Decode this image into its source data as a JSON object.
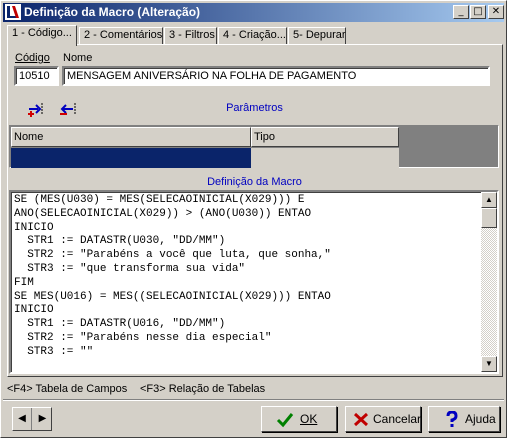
{
  "window": {
    "title": "Definição da Macro (Alteração)",
    "minimize_glyph": "_",
    "maximize_glyph": "□",
    "close_glyph": "✕"
  },
  "tabs": [
    {
      "label": "1 - Código...",
      "active": true
    },
    {
      "label": "2 - Comentários",
      "active": false
    },
    {
      "label": "3 - Filtros",
      "active": false
    },
    {
      "label": "4 - Criação...",
      "active": false
    },
    {
      "label": "5- Depurar",
      "active": false
    }
  ],
  "form": {
    "codigo_label": "Código",
    "codigo_value": "10510",
    "nome_label": "Nome",
    "nome_value": "MENSAGEM ANIVERSÁRIO NA FOLHA DE PAGAMENTO"
  },
  "parametros": {
    "title": "Parâmetros",
    "add_icon": "add-parameter-icon",
    "remove_icon": "remove-parameter-icon",
    "columns": [
      "Nome",
      "Tipo"
    ]
  },
  "definicao": {
    "title": "Definição da Macro",
    "code": "SE (MES(U030) = MES(SELECAOINICIAL(X029))) E\nANO(SELECAOINICIAL(X029)) > (ANO(U030)) ENTAO\nINICIO\n  STR1 := DATASTR(U030, \"DD/MM\")\n  STR2 := \"Parabéns a você que luta, que sonha,\"\n  STR3 := \"que transforma sua vida\"\nFIM\nSE MES(U016) = MES((SELECAOINICIAL(X029))) ENTAO\nINICIO\n  STR1 := DATASTR(U016, \"DD/MM\")\n  STR2 := \"Parabéns nesse dia especial\"\n  STR3 := \"\""
  },
  "statusbar": {
    "hint1": "<F4> Tabela de Campos",
    "hint2": "<F3> Relação de Tabelas"
  },
  "buttons": {
    "ok": "OK",
    "cancelar": "Cancelar",
    "ajuda": "Ajuda"
  },
  "colors": {
    "title_gradient_start": "#0a246a",
    "selected_cell": "#0a246a",
    "section_title": "#0000c0"
  }
}
